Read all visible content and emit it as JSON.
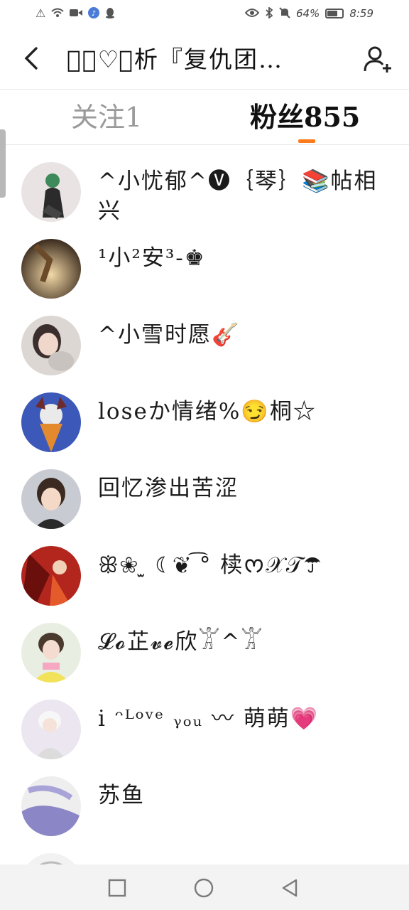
{
  "status_bar": {
    "battery_percent": "64%",
    "time": "8:59",
    "icons": [
      "alert-icon",
      "wifi-icon",
      "video-icon",
      "music-icon",
      "qq-icon",
      "eye-icon",
      "bluetooth-icon",
      "mute-icon",
      "battery-icon"
    ]
  },
  "header": {
    "title": "✏𝓜♡ூ析『复仇团…",
    "back_icon": "back-icon",
    "add_user_icon": "add-user-icon"
  },
  "tabs": [
    {
      "label": "关注1",
      "active": false
    },
    {
      "label": "粉丝855",
      "active": true
    }
  ],
  "accent_color": "#ff7a1a",
  "followers": [
    {
      "name": "^小忧郁^🅥｛琴｝📚帖相兴"
    },
    {
      "name": "¹小²安³-♚"
    },
    {
      "name": "^小雪时愿🎸"
    },
    {
      "name": "loseか情绪%😏桐☆"
    },
    {
      "name": "回忆渗出苦涩"
    },
    {
      "name": "ꕥ❀ ̫ ☾❦ ͡° 椟ᰔ𝒳𝒯☂"
    },
    {
      "name": "𝓛𝓸芷𝓿𝓮欣𓀠^𓀠"
    },
    {
      "name": "i ᵔᴸᵒᵛᵉ ᵧₒᵤ 〰 萌萌💗"
    },
    {
      "name": "苏鱼"
    }
  ],
  "nav": [
    "recents-button",
    "home-button",
    "back-nav-button"
  ]
}
